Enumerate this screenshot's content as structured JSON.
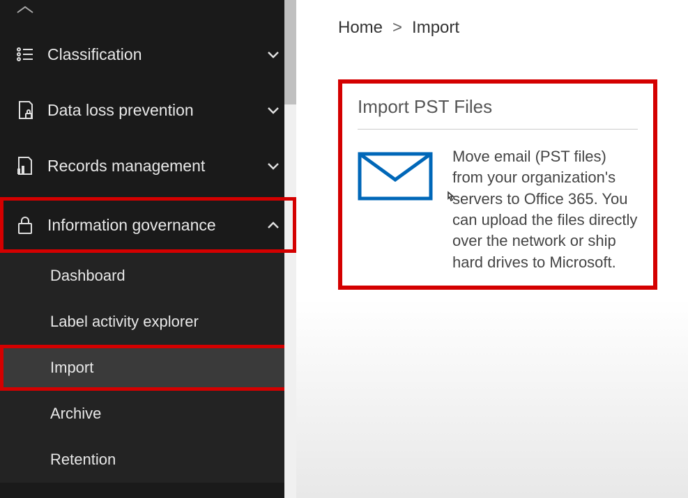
{
  "sidebar": {
    "classification": {
      "label": "Classification"
    },
    "dlp": {
      "label": "Data loss prevention"
    },
    "records": {
      "label": "Records management"
    },
    "infogov": {
      "label": "Information governance"
    },
    "subitems": {
      "dashboard": "Dashboard",
      "label_explorer": "Label activity explorer",
      "import": "Import",
      "archive": "Archive",
      "retention": "Retention"
    }
  },
  "breadcrumb": {
    "home": "Home",
    "sep": ">",
    "current": "Import"
  },
  "card": {
    "title": "Import PST Files",
    "description": "Move email (PST files) from your organization's servers to Office 365. You can upload the files directly over the network or ship hard drives to Microsoft."
  }
}
